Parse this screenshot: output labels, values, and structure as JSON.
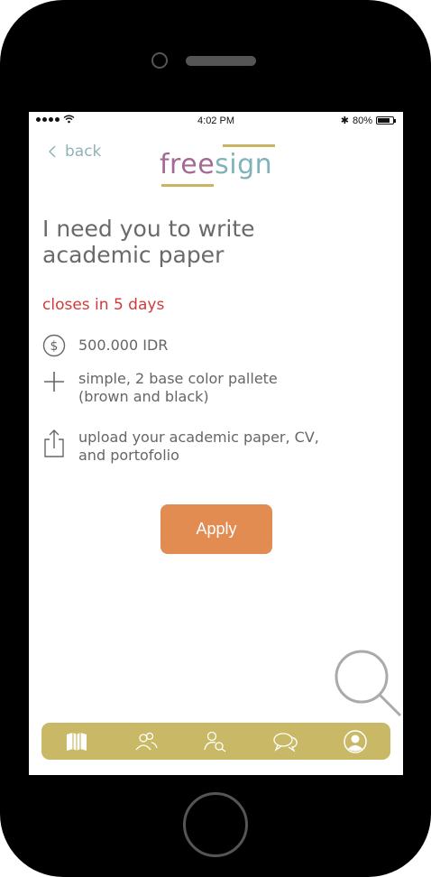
{
  "status_bar": {
    "time": "4:02 PM",
    "battery": "80%"
  },
  "header": {
    "back_label": "back",
    "logo_free": "free",
    "logo_sign": "sign"
  },
  "job": {
    "title_line1": "I need you to write",
    "title_line2": "academic paper",
    "closes": "closes in 5 days",
    "price": "500.000 IDR",
    "requirement_line1": "simple, 2 base color pallete",
    "requirement_line2": "(brown and black)",
    "upload_line1": "upload your academic paper, CV,",
    "upload_line2": "and portofolio"
  },
  "actions": {
    "apply_label": "Apply"
  },
  "colors": {
    "accent": "#e28c52",
    "tabbar": "#c9b967",
    "deadline": "#d23a3a",
    "logo_free": "#a46a95",
    "logo_sign": "#7fb3b8"
  },
  "tabs": [
    {
      "icon": "book-icon"
    },
    {
      "icon": "people-icon"
    },
    {
      "icon": "user-search-icon"
    },
    {
      "icon": "chat-icon"
    },
    {
      "icon": "profile-icon"
    }
  ]
}
